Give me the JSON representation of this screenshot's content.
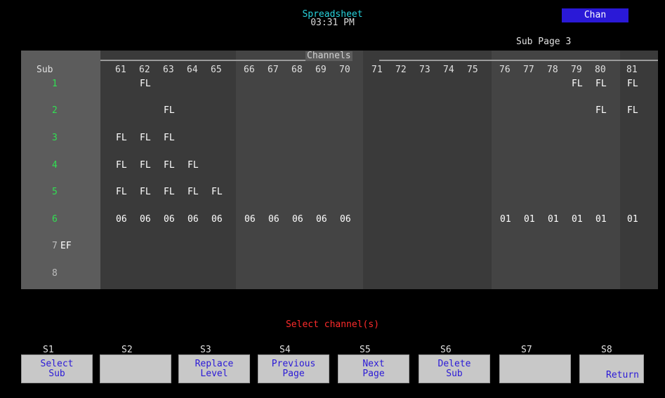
{
  "header": {
    "title": "Spreadsheet",
    "time": "03:31 PM",
    "mode": "Chan",
    "sub_page": "Sub Page 3"
  },
  "grid": {
    "group_label": "Channels",
    "sub_label": "Sub",
    "channels": [
      "61",
      "62",
      "63",
      "64",
      "65",
      "66",
      "67",
      "68",
      "69",
      "70",
      "71",
      "72",
      "73",
      "74",
      "75",
      "76",
      "77",
      "78",
      "79",
      "80",
      "81"
    ],
    "subs": [
      {
        "num": "1",
        "flag": ""
      },
      {
        "num": "2",
        "flag": ""
      },
      {
        "num": "3",
        "flag": ""
      },
      {
        "num": "4",
        "flag": ""
      },
      {
        "num": "5",
        "flag": ""
      },
      {
        "num": "6",
        "flag": ""
      },
      {
        "num": "7",
        "flag": "EF"
      },
      {
        "num": "8",
        "flag": ""
      }
    ],
    "cells": [
      {
        "sub": 1,
        "ch": 62,
        "value": "FL"
      },
      {
        "sub": 1,
        "ch": 79,
        "value": "FL"
      },
      {
        "sub": 1,
        "ch": 80,
        "value": "FL"
      },
      {
        "sub": 1,
        "ch": 81,
        "value": "FL"
      },
      {
        "sub": 2,
        "ch": 63,
        "value": "FL"
      },
      {
        "sub": 2,
        "ch": 80,
        "value": "FL"
      },
      {
        "sub": 2,
        "ch": 81,
        "value": "FL"
      },
      {
        "sub": 3,
        "ch": 61,
        "value": "FL"
      },
      {
        "sub": 3,
        "ch": 62,
        "value": "FL"
      },
      {
        "sub": 3,
        "ch": 63,
        "value": "FL"
      },
      {
        "sub": 4,
        "ch": 61,
        "value": "FL"
      },
      {
        "sub": 4,
        "ch": 62,
        "value": "FL"
      },
      {
        "sub": 4,
        "ch": 63,
        "value": "FL"
      },
      {
        "sub": 4,
        "ch": 64,
        "value": "FL"
      },
      {
        "sub": 5,
        "ch": 61,
        "value": "FL"
      },
      {
        "sub": 5,
        "ch": 62,
        "value": "FL"
      },
      {
        "sub": 5,
        "ch": 63,
        "value": "FL"
      },
      {
        "sub": 5,
        "ch": 64,
        "value": "FL"
      },
      {
        "sub": 5,
        "ch": 65,
        "value": "FL"
      },
      {
        "sub": 6,
        "ch": 61,
        "value": "06"
      },
      {
        "sub": 6,
        "ch": 62,
        "value": "06"
      },
      {
        "sub": 6,
        "ch": 63,
        "value": "06"
      },
      {
        "sub": 6,
        "ch": 64,
        "value": "06"
      },
      {
        "sub": 6,
        "ch": 65,
        "value": "06"
      },
      {
        "sub": 6,
        "ch": 66,
        "value": "06"
      },
      {
        "sub": 6,
        "ch": 67,
        "value": "06"
      },
      {
        "sub": 6,
        "ch": 68,
        "value": "06"
      },
      {
        "sub": 6,
        "ch": 69,
        "value": "06"
      },
      {
        "sub": 6,
        "ch": 70,
        "value": "06"
      },
      {
        "sub": 6,
        "ch": 76,
        "value": "01"
      },
      {
        "sub": 6,
        "ch": 77,
        "value": "01"
      },
      {
        "sub": 6,
        "ch": 78,
        "value": "01"
      },
      {
        "sub": 6,
        "ch": 79,
        "value": "01"
      },
      {
        "sub": 6,
        "ch": 80,
        "value": "01"
      },
      {
        "sub": 6,
        "ch": 81,
        "value": "01"
      }
    ]
  },
  "prompt": "Select channel(s)",
  "softkeys": [
    {
      "id": "S1",
      "line1": "Select",
      "line2": "Sub"
    },
    {
      "id": "S2",
      "line1": "",
      "line2": ""
    },
    {
      "id": "S3",
      "line1": "Replace",
      "line2": "Level"
    },
    {
      "id": "S4",
      "line1": "Previous",
      "line2": "Page"
    },
    {
      "id": "S5",
      "line1": "Next",
      "line2": "Page"
    },
    {
      "id": "S6",
      "line1": "Delete",
      "line2": "Sub"
    },
    {
      "id": "S7",
      "line1": "",
      "line2": ""
    },
    {
      "id": "S8",
      "line1": "",
      "line2": "Return"
    }
  ],
  "colors": {
    "title": "#27d3dd",
    "mode_badge": "#2a19d7",
    "sub_numbers": "#31e052",
    "prompt": "#ff2b2b",
    "softkey_text": "#2a19d7"
  }
}
